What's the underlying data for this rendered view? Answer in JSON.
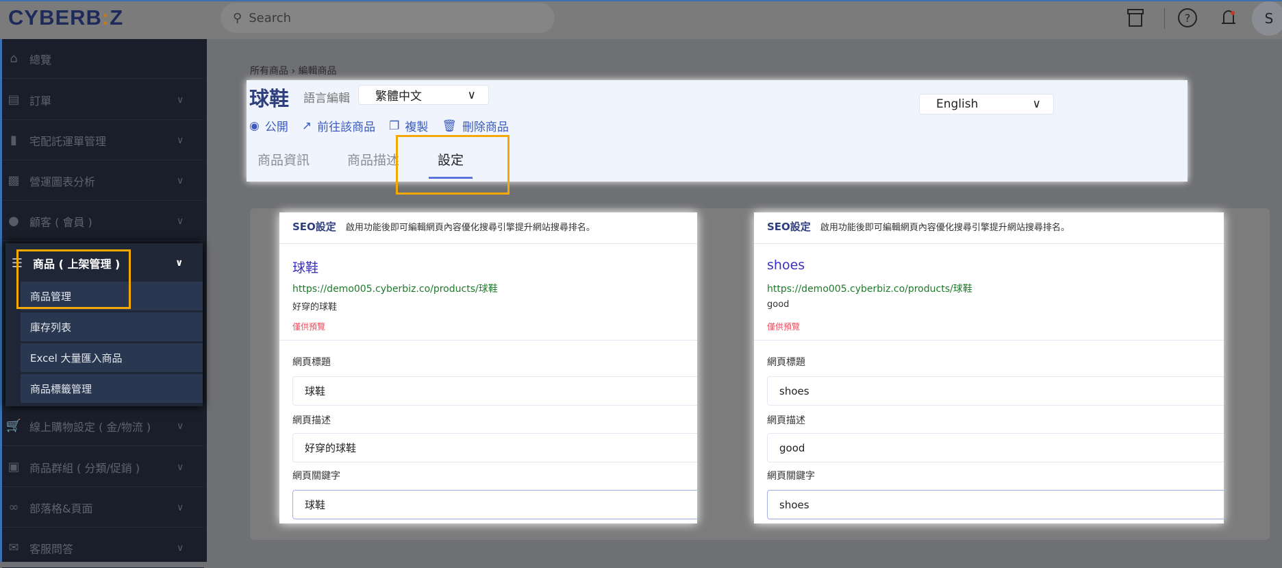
{
  "topbar": {
    "logo": "CYBERBIZ",
    "search_placeholder": "Search",
    "avatar_initial": "S",
    "icons": [
      "store-icon",
      "help-icon",
      "bell-icon"
    ]
  },
  "sidebar": {
    "items": [
      {
        "label": "總覽",
        "icon": "home-icon"
      },
      {
        "label": "訂單",
        "icon": "list-icon"
      },
      {
        "label": "宅配託運單管理",
        "icon": "file-icon"
      },
      {
        "label": "營運圖表分析",
        "icon": "bar-chart-icon"
      },
      {
        "label": "顧客 ( 會員 )",
        "icon": "users-icon"
      },
      {
        "label": "商品 ( 上架管理 )",
        "icon": "barcode-icon"
      },
      {
        "label": "線上購物設定 ( 金/物流 )",
        "icon": "cart-icon"
      },
      {
        "label": "商品群組 ( 分類/促銷 )",
        "icon": "briefcase-icon"
      },
      {
        "label": "部落格&頁面",
        "icon": "rss-icon"
      },
      {
        "label": "客服問答",
        "icon": "mail-icon"
      }
    ],
    "sub_items": [
      "商品管理",
      "庫存列表",
      "Excel 大量匯入商品",
      "商品標籤管理"
    ]
  },
  "main": {
    "breadcrumb": "所有商品 › 編輯商品",
    "title": "球鞋",
    "language_label": "語言編輯",
    "language_select": "繁體中文",
    "secondary_language_select": "English",
    "actions": [
      "公開",
      "前往該商品",
      "複製",
      "刪除商品"
    ],
    "tabs": [
      "商品資訊",
      "商品描述",
      "設定"
    ],
    "active_tab": "設定"
  },
  "seo_panels": [
    {
      "header": "SEO設定",
      "hint": "啟用功能後即可編輯網頁內容優化搜尋引擎提升網站搜尋排名。",
      "preview_title": "球鞋",
      "preview_url": "https://demo005.cyberbiz.co/products/球鞋",
      "preview_desc": "好穿的球鞋",
      "preview_note": "僅供預覽",
      "title_label": "網頁標題",
      "title_value": "球鞋",
      "desc_label": "網頁描述",
      "desc_value": "好穿的球鞋",
      "keywords_label": "網頁關鍵字",
      "keywords_value": "球鞋"
    },
    {
      "header": "SEO設定",
      "hint": "啟用功能後即可編輯網頁內容優化搜尋引擎提升網站搜尋排名。",
      "preview_title": "shoes",
      "preview_url": "https://demo005.cyberbiz.co/products/球鞋",
      "preview_desc": "good",
      "preview_note": "僅供預覽",
      "title_label": "網頁標題",
      "title_value": "shoes",
      "desc_label": "網頁描述",
      "desc_value": "good",
      "keywords_label": "網頁關鍵字",
      "keywords_value": "shoes"
    }
  ],
  "colors": {
    "highlight": "#f5a800",
    "accent": "#3b5bc0",
    "title": "#2e3f7c",
    "url": "#1e7a2a",
    "note": "#f04a5c"
  }
}
